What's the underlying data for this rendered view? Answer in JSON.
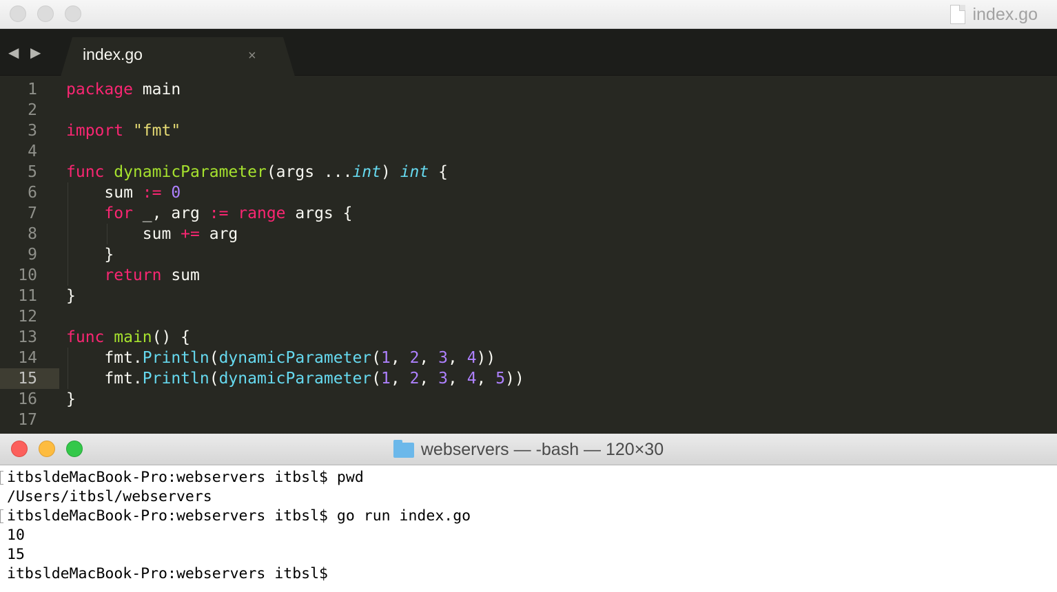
{
  "editor": {
    "window_title": "index.go",
    "tab": {
      "label": "index.go",
      "close_glyph": "×"
    },
    "nav": {
      "back": "◀",
      "forward": "▶"
    },
    "current_line": 15,
    "lines": [
      {
        "n": "1",
        "tokens": [
          [
            "kw",
            "package"
          ],
          [
            "pl",
            " main"
          ]
        ]
      },
      {
        "n": "2",
        "tokens": []
      },
      {
        "n": "3",
        "tokens": [
          [
            "kw",
            "import"
          ],
          [
            "pl",
            " "
          ],
          [
            "str",
            "\"fmt\""
          ]
        ]
      },
      {
        "n": "4",
        "tokens": []
      },
      {
        "n": "5",
        "tokens": [
          [
            "kw",
            "func"
          ],
          [
            "pl",
            " "
          ],
          [
            "fn",
            "dynamicParameter"
          ],
          [
            "pl",
            "(args ..."
          ],
          [
            "ty",
            "int"
          ],
          [
            "pl",
            ") "
          ],
          [
            "ty",
            "int"
          ],
          [
            "pl",
            " {"
          ]
        ]
      },
      {
        "n": "6",
        "tokens": [
          [
            "pl",
            "    sum "
          ],
          [
            "kw",
            ":="
          ],
          [
            "pl",
            " "
          ],
          [
            "num",
            "0"
          ]
        ]
      },
      {
        "n": "7",
        "tokens": [
          [
            "pl",
            "    "
          ],
          [
            "kw",
            "for"
          ],
          [
            "pl",
            " _, arg "
          ],
          [
            "kw",
            ":="
          ],
          [
            "pl",
            " "
          ],
          [
            "kw",
            "range"
          ],
          [
            "pl",
            " args {"
          ]
        ]
      },
      {
        "n": "8",
        "tokens": [
          [
            "pl",
            "        sum "
          ],
          [
            "kw",
            "+="
          ],
          [
            "pl",
            " arg"
          ]
        ]
      },
      {
        "n": "9",
        "tokens": [
          [
            "pl",
            "    }"
          ]
        ]
      },
      {
        "n": "10",
        "tokens": [
          [
            "pl",
            "    "
          ],
          [
            "kw",
            "return"
          ],
          [
            "pl",
            " sum"
          ]
        ]
      },
      {
        "n": "11",
        "tokens": [
          [
            "pl",
            "}"
          ]
        ]
      },
      {
        "n": "12",
        "tokens": []
      },
      {
        "n": "13",
        "tokens": [
          [
            "kw",
            "func"
          ],
          [
            "pl",
            " "
          ],
          [
            "fn",
            "main"
          ],
          [
            "pl",
            "() {"
          ]
        ]
      },
      {
        "n": "14",
        "tokens": [
          [
            "pl",
            "    fmt."
          ],
          [
            "call",
            "Println"
          ],
          [
            "pl",
            "("
          ],
          [
            "call",
            "dynamicParameter"
          ],
          [
            "pl",
            "("
          ],
          [
            "num",
            "1"
          ],
          [
            "pl",
            ", "
          ],
          [
            "num",
            "2"
          ],
          [
            "pl",
            ", "
          ],
          [
            "num",
            "3"
          ],
          [
            "pl",
            ", "
          ],
          [
            "num",
            "4"
          ],
          [
            "pl",
            "))"
          ]
        ]
      },
      {
        "n": "15",
        "tokens": [
          [
            "pl",
            "    fmt."
          ],
          [
            "call",
            "Println"
          ],
          [
            "pl",
            "("
          ],
          [
            "call",
            "dynamicParameter"
          ],
          [
            "pl",
            "("
          ],
          [
            "num",
            "1"
          ],
          [
            "pl",
            ", "
          ],
          [
            "num",
            "2"
          ],
          [
            "pl",
            ", "
          ],
          [
            "num",
            "3"
          ],
          [
            "pl",
            ", "
          ],
          [
            "num",
            "4"
          ],
          [
            "pl",
            ", "
          ],
          [
            "num",
            "5"
          ],
          [
            "pl",
            "))"
          ]
        ]
      },
      {
        "n": "16",
        "tokens": [
          [
            "pl",
            "}"
          ]
        ]
      },
      {
        "n": "17",
        "tokens": []
      }
    ],
    "colors": {
      "background": "#272822",
      "keyword": "#f92672",
      "function": "#a6e22e",
      "type": "#66d9ef",
      "string": "#e6db74",
      "number": "#ae81ff",
      "plain": "#f8f8f2"
    }
  },
  "terminal": {
    "title": "webservers — -bash — 120×30",
    "folder_icon": "folder-icon",
    "lines": [
      {
        "text": "itbsldeMacBook-Pro:webservers itbsl$ pwd",
        "marked": true
      },
      {
        "text": "/Users/itbsl/webservers",
        "marked": false
      },
      {
        "text": "itbsldeMacBook-Pro:webservers itbsl$ go run index.go",
        "marked": true
      },
      {
        "text": "10",
        "marked": false
      },
      {
        "text": "15",
        "marked": false
      },
      {
        "text": "itbsldeMacBook-Pro:webservers itbsl$ ",
        "marked": false
      }
    ]
  }
}
